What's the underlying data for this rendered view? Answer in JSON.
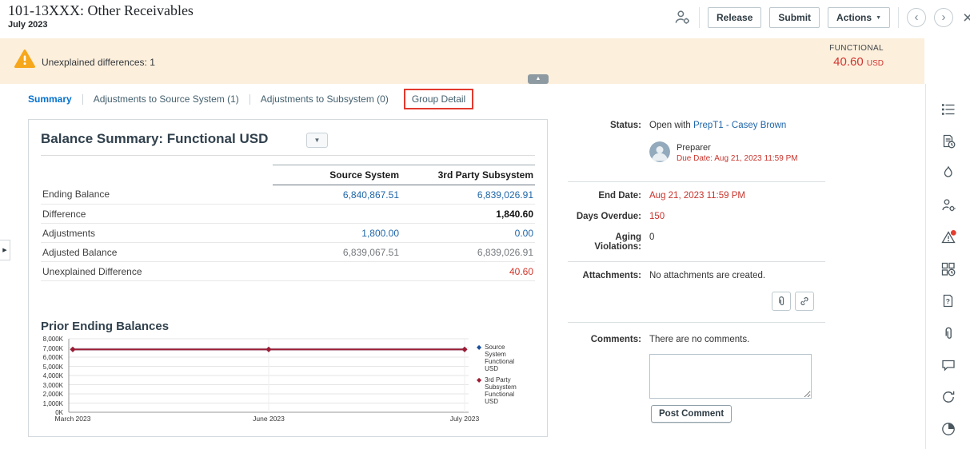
{
  "header": {
    "title": "101-13XXX: Other Receivables",
    "period": "July 2023",
    "release": "Release",
    "submit": "Submit",
    "actions": "Actions"
  },
  "banner": {
    "message": "Unexplained differences: 1",
    "currency_type": "FUNCTIONAL",
    "amount": "40.60",
    "currency": "USD"
  },
  "tabs": [
    {
      "label": "Summary"
    },
    {
      "label": "Adjustments to Source System (1)"
    },
    {
      "label": "Adjustments to Subsystem (0)"
    },
    {
      "label": "Group Detail"
    }
  ],
  "balance_summary": {
    "title": "Balance Summary: Functional USD",
    "columns": {
      "col1": "Source System",
      "col2": "3rd Party Subsystem"
    },
    "rows": [
      {
        "label": "Ending Balance",
        "source": "6,840,867.51",
        "subsystem": "6,839,026.91"
      },
      {
        "label": "Difference",
        "source": "",
        "subsystem": "1,840.60"
      },
      {
        "label": "Adjustments",
        "source": "1,800.00",
        "subsystem": "0.00"
      },
      {
        "label": "Adjusted Balance",
        "source": "6,839,067.51",
        "subsystem": "6,839,026.91"
      },
      {
        "label": "Unexplained Difference",
        "source": "",
        "subsystem": "40.60"
      }
    ]
  },
  "chart_data": {
    "type": "line",
    "title": "Prior Ending Balances",
    "x": [
      "March 2023",
      "June 2023",
      "July 2023"
    ],
    "series": [
      {
        "name": "Source System Functional USD",
        "color": "#1a4f9c",
        "values": [
          6840867.51,
          6840867.51,
          6840867.51
        ]
      },
      {
        "name": "3rd Party Subsystem Functional USD",
        "color": "#9e1b32",
        "values": [
          6839026.91,
          6839026.91,
          6839026.91
        ]
      }
    ],
    "ylim": [
      0,
      8000000
    ],
    "ytick_step": 1000000,
    "ytick_labels": [
      "0K",
      "1,000K",
      "2,000K",
      "3,000K",
      "4,000K",
      "5,000K",
      "6,000K",
      "7,000K",
      "8,000K"
    ],
    "legend_position": "right",
    "grid": true
  },
  "panel": {
    "status_label": "Status:",
    "status_prefix": "Open with",
    "status_link": "PrepT1 - Casey Brown",
    "role": "Preparer",
    "due_date": "Due Date: Aug 21, 2023 11:59 PM",
    "end_date_label": "End Date:",
    "end_date": "Aug 21, 2023 11:59 PM",
    "days_overdue_label": "Days Overdue:",
    "days_overdue": "150",
    "aging_label": "Aging Violations:",
    "aging": "0",
    "attachments_label": "Attachments:",
    "attachments_text": "No attachments are created.",
    "comments_label": "Comments:",
    "comments_text": "There are no comments.",
    "post_comment": "Post Comment"
  },
  "rail_icons": [
    "Properties",
    "Instructions",
    "Alerts",
    "Workflow",
    "Warnings",
    "Transactions",
    "Questions",
    "Attachments",
    "Comments",
    "History",
    "Summary"
  ],
  "icons": {
    "close": "×",
    "chevron_left": "‹",
    "chevron_right": "›",
    "caret_down": "▼",
    "collapse": "▲",
    "dropdown": "▼",
    "expand": "▶",
    "legend_marker": "◆"
  },
  "colors": {
    "accent": "#0572ce",
    "alert_red": "#c8342c",
    "link_blue": "#1f66a8",
    "banner_bg": "#fcefdc"
  }
}
